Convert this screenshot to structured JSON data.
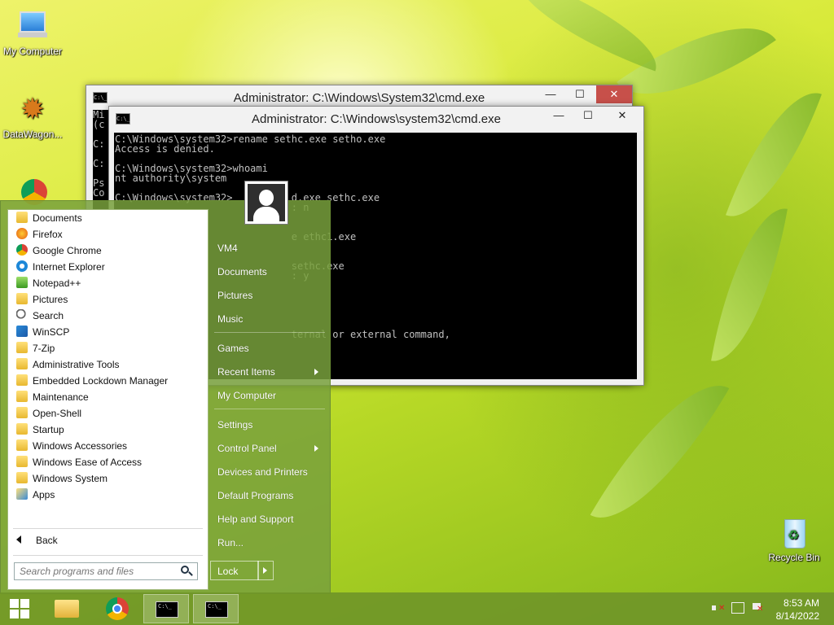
{
  "desktop": {
    "icons": [
      {
        "label": "My Computer"
      },
      {
        "label": "DataWagon..."
      },
      {
        "label": "Recycle Bin"
      }
    ]
  },
  "cmd_back": {
    "title": "Administrator: C:\\Windows\\System32\\cmd.exe",
    "minimize": "—",
    "maximize": "☐",
    "close": "✕",
    "lines": "Mi\n(c\n\nC:\n\nC:\n\nPs\nCo"
  },
  "cmd_front": {
    "title": "Administrator: C:\\Windows\\system32\\cmd.exe",
    "minimize": "—",
    "maximize": "☐",
    "close": "✕",
    "lines": "C:\\Windows\\system32>rename sethc.exe setho.exe\nAccess is denied.\n\nC:\\Windows\\system32>whoami\nnt authority\\system\n\nC:\\Windows\\system32>          d.exe sethc.exe\n                              : n\n\n\n                              e ethc1.exe\n\n\n                              sethc.exe\n                              : y\n\n\n\n\n\n                              ternal or external command,"
  },
  "start_menu": {
    "programs": [
      {
        "label": "Documents",
        "icon": "folder-icon"
      },
      {
        "label": "Firefox",
        "icon": "firefox-icon"
      },
      {
        "label": "Google Chrome",
        "icon": "chrome-icon"
      },
      {
        "label": "Internet Explorer",
        "icon": "ie-icon"
      },
      {
        "label": "Notepad++",
        "icon": "notepadpp-icon"
      },
      {
        "label": "Pictures",
        "icon": "folder-icon"
      },
      {
        "label": "Search",
        "icon": "search-icon"
      },
      {
        "label": "WinSCP",
        "icon": "winscp-icon"
      },
      {
        "label": "7-Zip",
        "icon": "folder-icon"
      },
      {
        "label": "Administrative Tools",
        "icon": "folder-icon"
      },
      {
        "label": "Embedded Lockdown Manager",
        "icon": "folder-icon"
      },
      {
        "label": "Maintenance",
        "icon": "folder-icon"
      },
      {
        "label": "Open-Shell",
        "icon": "folder-icon"
      },
      {
        "label": "Startup",
        "icon": "folder-icon"
      },
      {
        "label": "Windows Accessories",
        "icon": "folder-icon"
      },
      {
        "label": "Windows Ease of Access",
        "icon": "folder-icon"
      },
      {
        "label": "Windows System",
        "icon": "folder-icon"
      },
      {
        "label": "Apps",
        "icon": "apps-icon"
      }
    ],
    "back_label": "Back",
    "search_placeholder": "Search programs and files",
    "right_items": [
      {
        "label": "VM4"
      },
      {
        "label": "Documents"
      },
      {
        "label": "Pictures"
      },
      {
        "label": "Music"
      },
      {
        "label": "Games"
      },
      {
        "label": "Recent Items",
        "submenu": true
      },
      {
        "label": "My Computer"
      },
      {
        "label": "Settings"
      },
      {
        "label": "Control Panel",
        "submenu": true
      },
      {
        "label": "Devices and Printers"
      },
      {
        "label": "Default Programs"
      },
      {
        "label": "Help and Support"
      },
      {
        "label": "Run..."
      }
    ],
    "lock_label": "Lock"
  },
  "taskbar": {
    "cmd_icon_text": "C:\\_",
    "clock_time": "8:53 AM",
    "clock_date": "8/14/2022"
  }
}
